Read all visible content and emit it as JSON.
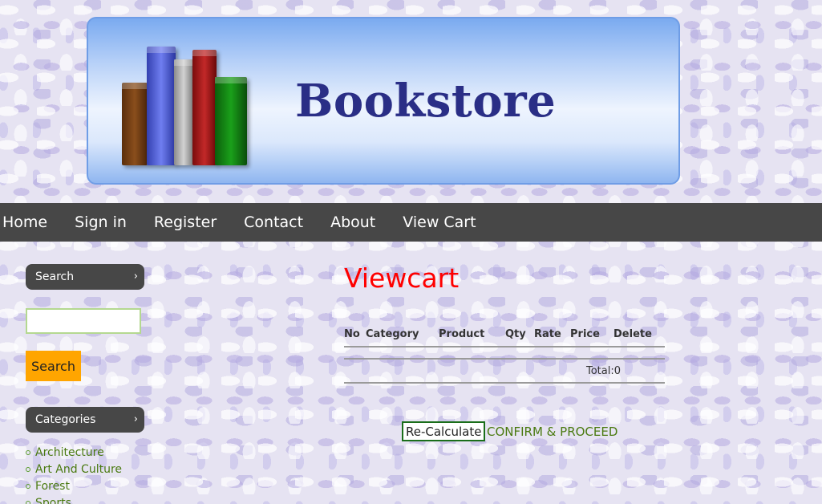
{
  "header": {
    "brand": "Bookstore"
  },
  "nav": {
    "items": [
      {
        "label": "Home"
      },
      {
        "label": "Sign in"
      },
      {
        "label": "Register"
      },
      {
        "label": "Contact"
      },
      {
        "label": "About"
      },
      {
        "label": "View Cart"
      }
    ]
  },
  "sidebar": {
    "search_heading": "Search",
    "search_value": "",
    "search_button": "Search",
    "categories_heading": "Categories",
    "categories": [
      {
        "label": "Architecture"
      },
      {
        "label": "Art And Culture"
      },
      {
        "label": "Forest"
      },
      {
        "label": "Sports"
      }
    ]
  },
  "main": {
    "title": "Viewcart",
    "columns": [
      "No",
      "Category",
      "Product",
      "Qty",
      "Rate",
      "Price",
      "Delete"
    ],
    "total_label": "Total:0",
    "recalc_button": "Re-Calculate",
    "confirm_link": "CONFIRM & PROCEED"
  },
  "colors": {
    "nav_bg": "#474747",
    "accent_orange": "#ffa500",
    "title_red": "#ff0000",
    "link_green": "#4a7a10"
  },
  "icons": {
    "sidebar_heading_chevron": "chevron-right-icon",
    "category_bullet": "circle-bullet-icon"
  }
}
